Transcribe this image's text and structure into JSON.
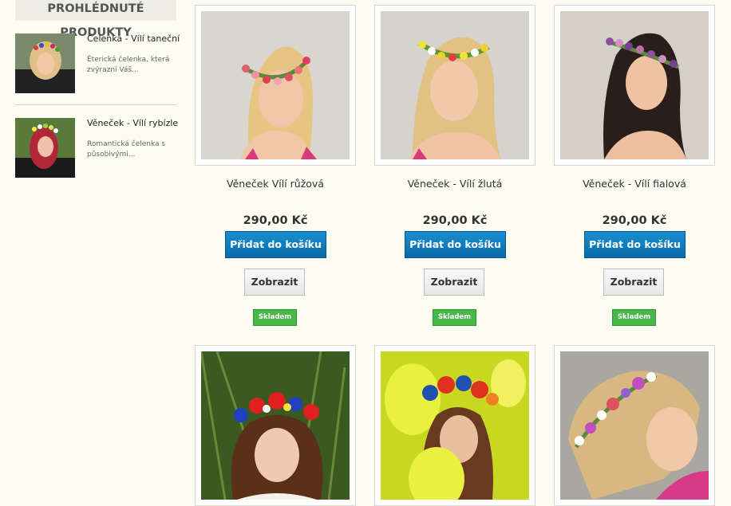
{
  "sidebar": {
    "title": "PROHLÉDNUTÉ PRODUKTY",
    "items": [
      {
        "name": "Čelenka - Vílí taneční",
        "description": "Éterická čelenka, která zvýrazní Váš..."
      },
      {
        "name": "Věneček - Vílí rybízle",
        "description": "Romantická čelenka s působivými..."
      }
    ]
  },
  "products": [
    {
      "name": "Věneček Vílí růžová",
      "price": "290,00 Kč",
      "add_to_cart": "Přidat do košíku",
      "view": "Zobrazit",
      "stock": "Skladem"
    },
    {
      "name": "Věneček - Vílí žlutá",
      "price": "290,00 Kč",
      "add_to_cart": "Přidat do košíku",
      "view": "Zobrazit",
      "stock": "Skladem"
    },
    {
      "name": "Věneček - Vílí fialová",
      "price": "290,00 Kč",
      "add_to_cart": "Přidat do košíku",
      "view": "Zobrazit",
      "stock": "Skladem"
    }
  ],
  "colors": {
    "cart_button": "#1280c4",
    "stock_badge": "#46b748",
    "background": "#fcfcf2"
  }
}
